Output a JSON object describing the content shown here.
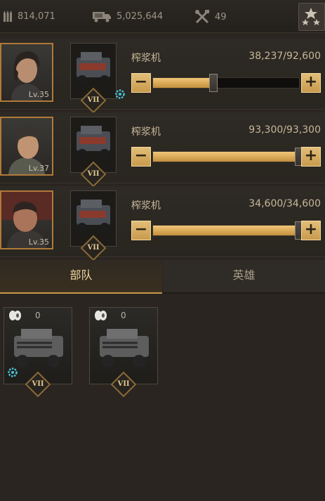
{
  "resources": {
    "ammo": "814,071",
    "cargo": "5,025,644",
    "tools": "49"
  },
  "assignments": [
    {
      "hero_level": "Lv.35",
      "vehicle_tier": "VII",
      "vehicle_name": "榨浆机",
      "count": "38,237/92,600",
      "fill_fraction": 0.413,
      "has_gear_badge": true
    },
    {
      "hero_level": "Lv.37",
      "vehicle_tier": "VII",
      "vehicle_name": "榨浆机",
      "count": "93,300/93,300",
      "fill_fraction": 1.0,
      "has_gear_badge": false
    },
    {
      "hero_level": "Lv.35",
      "vehicle_tier": "VII",
      "vehicle_name": "榨浆机",
      "count": "34,600/34,600",
      "fill_fraction": 1.0,
      "has_gear_badge": false
    }
  ],
  "stepper": {
    "minus": "−",
    "plus": "+"
  },
  "tabs": {
    "troops": "部队",
    "heroes": "英雄",
    "active": "troops"
  },
  "troop_cards": [
    {
      "count": "0",
      "tier": "VII",
      "has_gear_badge": true
    },
    {
      "count": "0",
      "tier": "VII",
      "has_gear_badge": false
    }
  ],
  "colors": {
    "accent": "#c9974b",
    "frame": "#b07a39",
    "badge": "#49c3d8"
  }
}
